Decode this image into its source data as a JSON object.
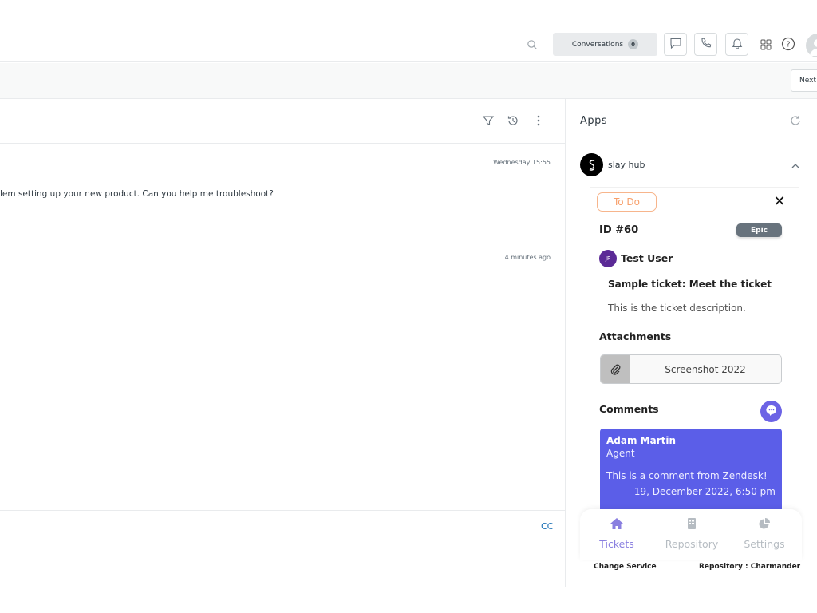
{
  "topbar": {
    "search_icon": "search-icon",
    "conversations_label": "Conversations",
    "conversations_count": "0",
    "icons": [
      "chat-icon",
      "phone-icon",
      "bell-icon",
      "apps-grid-icon",
      "help-icon",
      "user-avatar-icon"
    ]
  },
  "subbar": {
    "next_label": "Next"
  },
  "conversation": {
    "header_icons": [
      "filter-icon",
      "history-icon",
      "more-options-icon"
    ],
    "messages": [
      {
        "timestamp": "Wednesday 15:55",
        "text": "lem setting up your new product. Can you help me troubleshoot?"
      },
      {
        "timestamp": "4 minutes ago",
        "text": ""
      }
    ],
    "composer": {
      "cc_label": "CC"
    }
  },
  "apps_panel": {
    "title": "Apps",
    "app": {
      "name": "slay hub",
      "ticket": {
        "status": "To Do",
        "id": "ID #60",
        "type": "Epic",
        "user_initials": "JP",
        "user_name": "Test User",
        "title": "Sample ticket: Meet the ticket",
        "description": "This is the ticket description.",
        "attachments_label": "Attachments",
        "attachments": [
          {
            "name": "Screenshot 2022"
          }
        ],
        "comments_label": "Comments",
        "comments": [
          {
            "author": "Adam Martin",
            "role": "Agent",
            "text": "This is a comment from Zendesk!",
            "date": "19, December 2022, 6:50 pm"
          }
        ]
      },
      "nav": [
        {
          "label": "Tickets",
          "icon": "home-icon",
          "active": true
        },
        {
          "label": "Repository",
          "icon": "repository-icon",
          "active": false
        },
        {
          "label": "Settings",
          "icon": "pie-chart-icon",
          "active": false
        }
      ],
      "footer": {
        "change_service": "Change Service",
        "repository": "Repository : Charmander"
      }
    }
  },
  "colors": {
    "accent_purple": "#5b5ee8",
    "todo_orange": "#f7a06c",
    "link_blue": "#1f73b7",
    "epic_gray": "#68737d"
  }
}
